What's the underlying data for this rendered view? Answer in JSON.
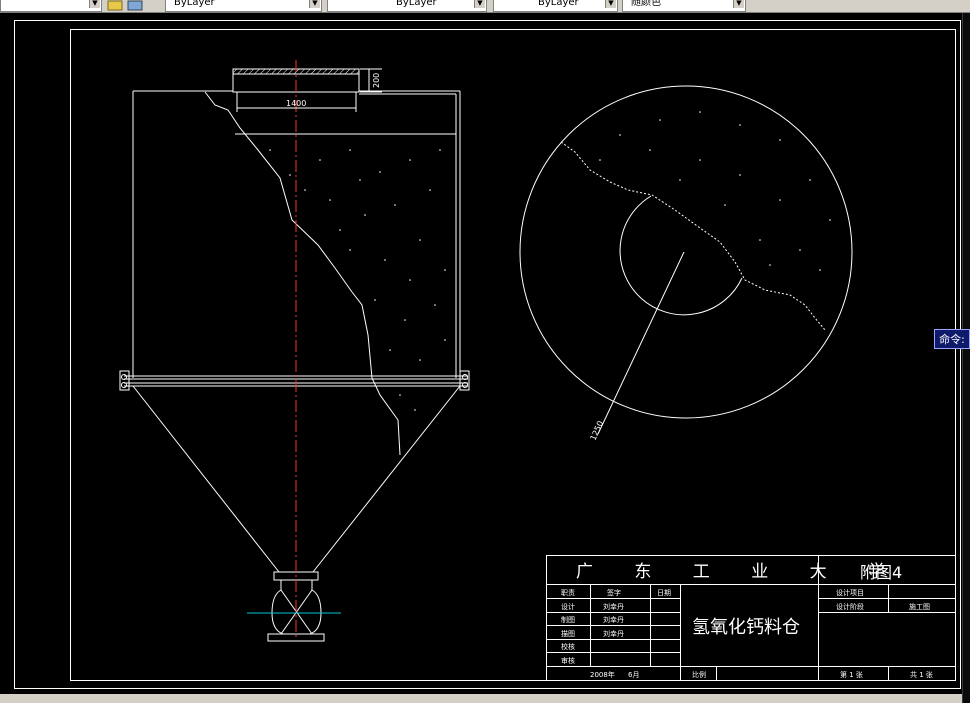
{
  "toolbar": {
    "color_dropdown": "ByLayer",
    "linetype_dropdown": "ByLayer",
    "lineweight_dropdown": "ByLayer",
    "plotstyle_dropdown": "随颜色"
  },
  "command_label": "命令:",
  "drawing": {
    "dim_width": "1400",
    "dim_height": "200",
    "dim_radius": "1250"
  },
  "title_block": {
    "school": "广 东 工 业 大 学",
    "figure_no": "附图4",
    "drawing_title": "氢氧化钙料仓",
    "rows": [
      {
        "label": "职责",
        "name": "签字",
        "date": "日期"
      },
      {
        "label": "设计",
        "name": "刘幸丹",
        "date": ""
      },
      {
        "label": "制图",
        "name": "刘幸丹",
        "date": ""
      },
      {
        "label": "描图",
        "name": "刘幸丹",
        "date": ""
      },
      {
        "label": "校核",
        "name": "",
        "date": ""
      },
      {
        "label": "审核",
        "name": "",
        "date": ""
      }
    ],
    "date_year": "2008年",
    "date_month": "6月",
    "scale_label": "比例",
    "project_label": "设计项目",
    "stage_label": "设计阶段",
    "stage_value": "施工图",
    "sheet_no": "第 1 张",
    "sheet_total": "共 1 张"
  },
  "colors": {
    "line": "#ffffff",
    "centerline": "#ff3030",
    "cyan": "#00c8d0",
    "command_bg": "#0f1a6b"
  }
}
